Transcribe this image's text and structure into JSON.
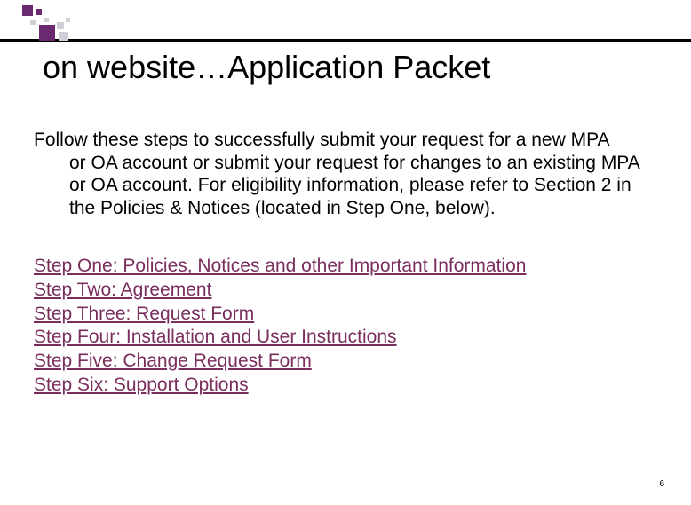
{
  "title": "on website…Application Packet",
  "description_first": "Follow these steps to successfully submit your request for a new MPA",
  "description_rest": "or OA account or submit your request for changes to an existing MPA or OA account. For eligibility information, please refer to Section 2 in the Policies & Notices (located in Step One, below).",
  "steps": [
    "Step One: Policies, Notices and other Important Information",
    "Step Two: Agreement",
    "Step Three: Request Form",
    "Step Four: Installation and User Instructions",
    "Step Five: Change Request Form",
    "Step Six: Support Options"
  ],
  "page_number": "6"
}
